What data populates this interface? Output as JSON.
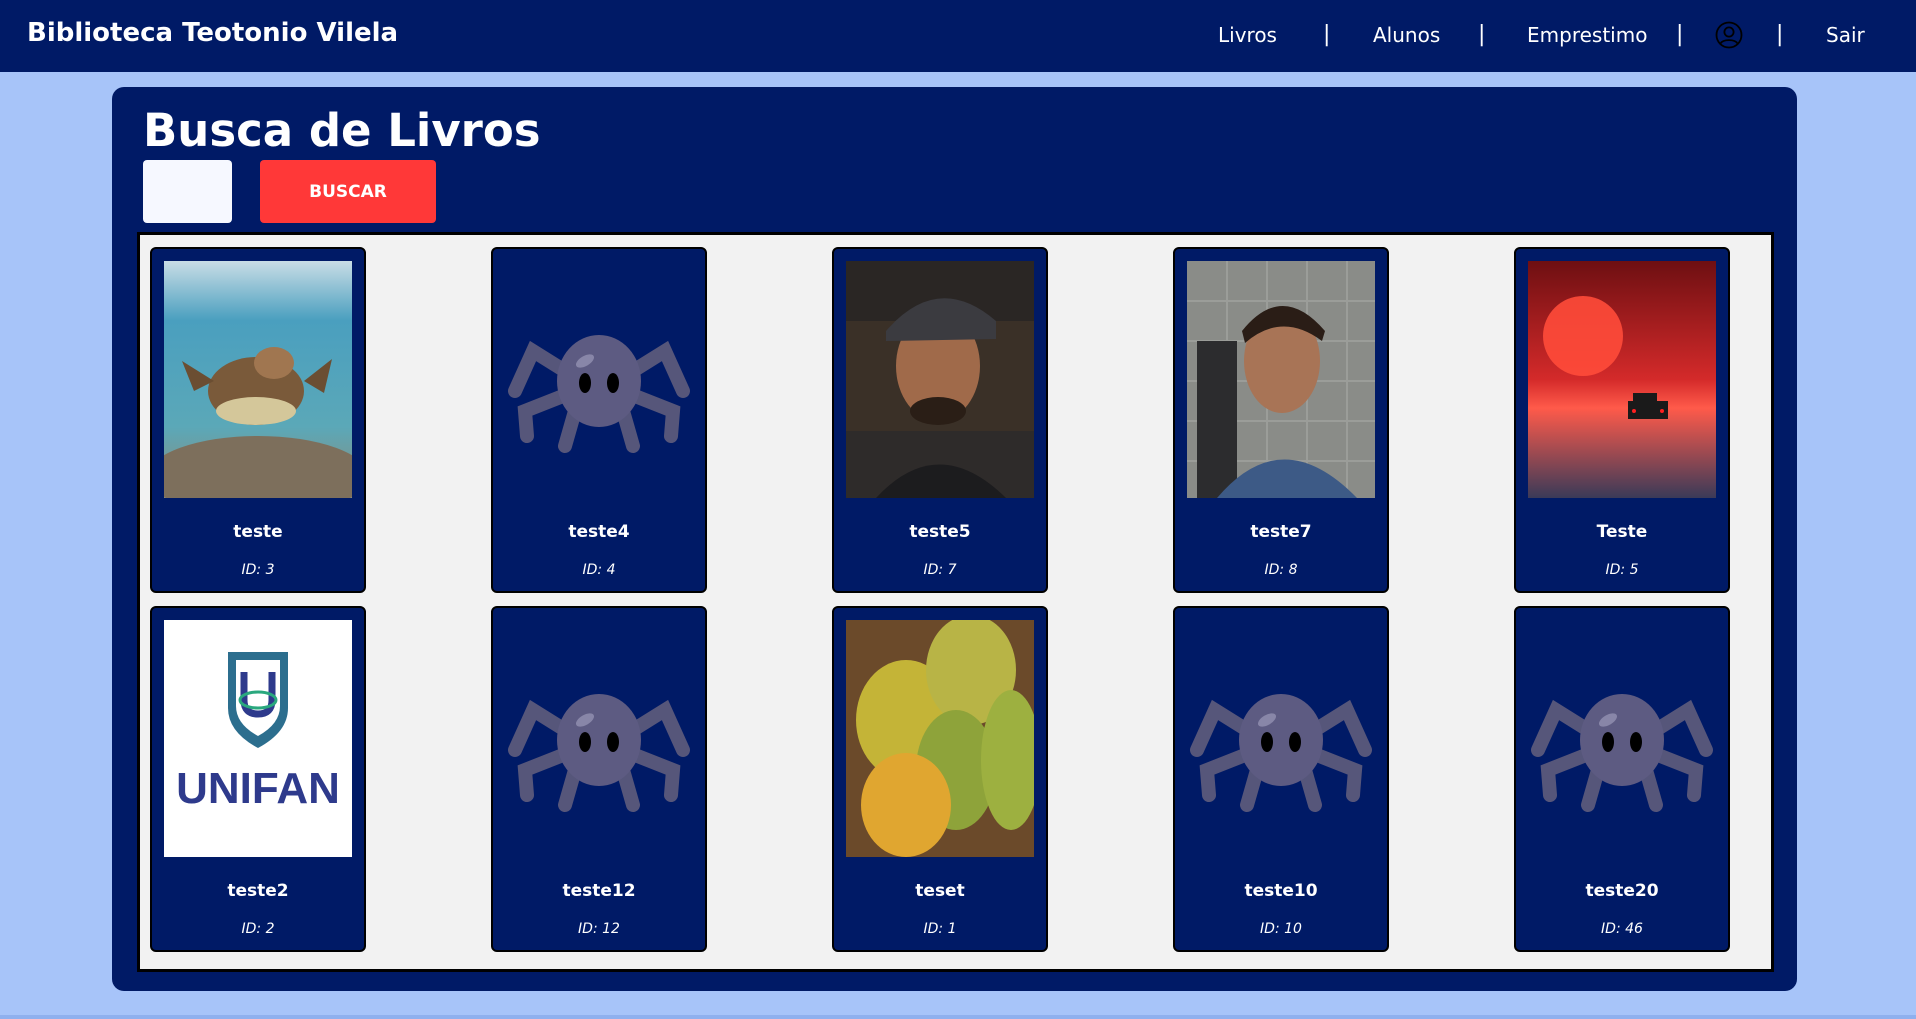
{
  "header": {
    "brand": "Biblioteca Teotonio Vilela",
    "nav": {
      "livros": "Livros",
      "alunos": "Alunos",
      "emprestimo": "Emprestimo",
      "sair": "Sair",
      "separator": "|",
      "user_icon": "user-circle-icon"
    }
  },
  "main": {
    "title": "Busca de Livros",
    "search": {
      "value": "",
      "placeholder": ""
    },
    "button_label": "BUSCAR"
  },
  "books": [
    {
      "title": "teste",
      "id": "ID: 3",
      "cover": "sea-turtle-photo"
    },
    {
      "title": "teste4",
      "id": "ID: 4",
      "cover": "spider-placeholder-icon"
    },
    {
      "title": "teste5",
      "id": "ID: 7",
      "cover": "man-with-cap-photo"
    },
    {
      "title": "teste7",
      "id": "ID: 8",
      "cover": "man-portrait-photo"
    },
    {
      "title": "Teste",
      "id": "ID: 5",
      "cover": "red-sky-car-photo"
    },
    {
      "title": "teste2",
      "id": "ID: 2",
      "cover": "unifan-logo",
      "logo_text": "UNIFAN"
    },
    {
      "title": "teste12",
      "id": "ID: 12",
      "cover": "spider-placeholder-icon"
    },
    {
      "title": "teset",
      "id": "ID: 1",
      "cover": "mangoes-photo"
    },
    {
      "title": "teste10",
      "id": "ID: 10",
      "cover": "spider-placeholder-icon"
    },
    {
      "title": "teste20",
      "id": "ID: 46",
      "cover": "spider-placeholder-icon"
    }
  ],
  "colors": {
    "navy": "#001a66",
    "page_bg": "#a7c4f9",
    "button": "#ff3838",
    "grid_bg": "#f2f2f2"
  }
}
